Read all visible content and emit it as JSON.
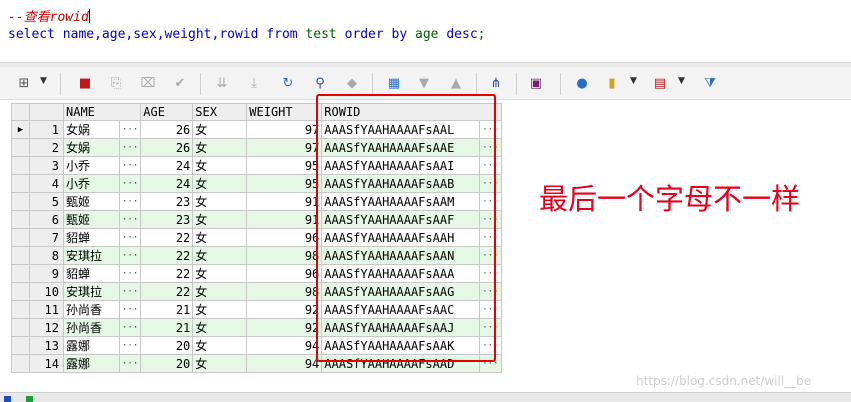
{
  "editor": {
    "comment": "--查看rowid",
    "sql": {
      "part1": "select name,age,sex,weight,",
      "rowid": "rowid",
      "sp1": " ",
      "from": "from",
      "part2": " test ",
      "order": "order",
      "sp2": " ",
      "by": "by",
      "part3": " age ",
      "desc": "desc",
      "end": ";"
    }
  },
  "toolbar": {
    "icons": [
      "table-select-icon",
      "lock-icon",
      "new-row-icon",
      "delete-row-icon",
      "post-icon",
      "move-down-icon",
      "move-bottom-icon",
      "refresh-icon",
      "find-icon",
      "clear-icon",
      "grid-icon",
      "next-icon",
      "prev-icon",
      "link-icon",
      "save-icon",
      "query-icon",
      "chart-icon",
      "table-view-icon",
      "filter-icon"
    ]
  },
  "grid": {
    "headers": {
      "name": "NAME",
      "age": "AGE",
      "sex": "SEX",
      "weight": "WEIGHT",
      "rowid": "ROWID"
    },
    "rows": [
      {
        "n": "1",
        "name": "女娲",
        "age": "26",
        "sex": "女",
        "weight": "97",
        "rowid": "AAASfYAAHAAAAFsAAL"
      },
      {
        "n": "2",
        "name": "女娲",
        "age": "26",
        "sex": "女",
        "weight": "97",
        "rowid": "AAASfYAAHAAAAFsAAE"
      },
      {
        "n": "3",
        "name": "小乔",
        "age": "24",
        "sex": "女",
        "weight": "95",
        "rowid": "AAASfYAAHAAAAFsAAI"
      },
      {
        "n": "4",
        "name": "小乔",
        "age": "24",
        "sex": "女",
        "weight": "95",
        "rowid": "AAASfYAAHAAAAFsAAB"
      },
      {
        "n": "5",
        "name": "甄姬",
        "age": "23",
        "sex": "女",
        "weight": "91",
        "rowid": "AAASfYAAHAAAAFsAAM"
      },
      {
        "n": "6",
        "name": "甄姬",
        "age": "23",
        "sex": "女",
        "weight": "91",
        "rowid": "AAASfYAAHAAAAFsAAF"
      },
      {
        "n": "7",
        "name": "貂蝉",
        "age": "22",
        "sex": "女",
        "weight": "96",
        "rowid": "AAASfYAAHAAAAFsAAH"
      },
      {
        "n": "8",
        "name": "安琪拉",
        "age": "22",
        "sex": "女",
        "weight": "98",
        "rowid": "AAASfYAAHAAAAFsAAN"
      },
      {
        "n": "9",
        "name": "貂蝉",
        "age": "22",
        "sex": "女",
        "weight": "96",
        "rowid": "AAASfYAAHAAAAFsAAA"
      },
      {
        "n": "10",
        "name": "安琪拉",
        "age": "22",
        "sex": "女",
        "weight": "98",
        "rowid": "AAASfYAAHAAAAFsAAG"
      },
      {
        "n": "11",
        "name": "孙尚香",
        "age": "21",
        "sex": "女",
        "weight": "92",
        "rowid": "AAASfYAAHAAAAFsAAC"
      },
      {
        "n": "12",
        "name": "孙尚香",
        "age": "21",
        "sex": "女",
        "weight": "92",
        "rowid": "AAASfYAAHAAAAFsAAJ"
      },
      {
        "n": "13",
        "name": "露娜",
        "age": "20",
        "sex": "女",
        "weight": "94",
        "rowid": "AAASfYAAHAAAAFsAAK"
      },
      {
        "n": "14",
        "name": "露娜",
        "age": "20",
        "sex": "女",
        "weight": "94",
        "rowid": "AAASfYAAHAAAAFsAAD"
      }
    ],
    "dots": "···",
    "current_marker": "▶"
  },
  "annotation": {
    "text": "最后一个字母不一样",
    "color": "#e8001c"
  },
  "watermark": "https://blog.csdn.net/will__be",
  "colors": {
    "alt_row": "#e5f7e5",
    "highlight_border": "#e60000",
    "keyword": "#0000cc",
    "comment": "#cc0000"
  }
}
